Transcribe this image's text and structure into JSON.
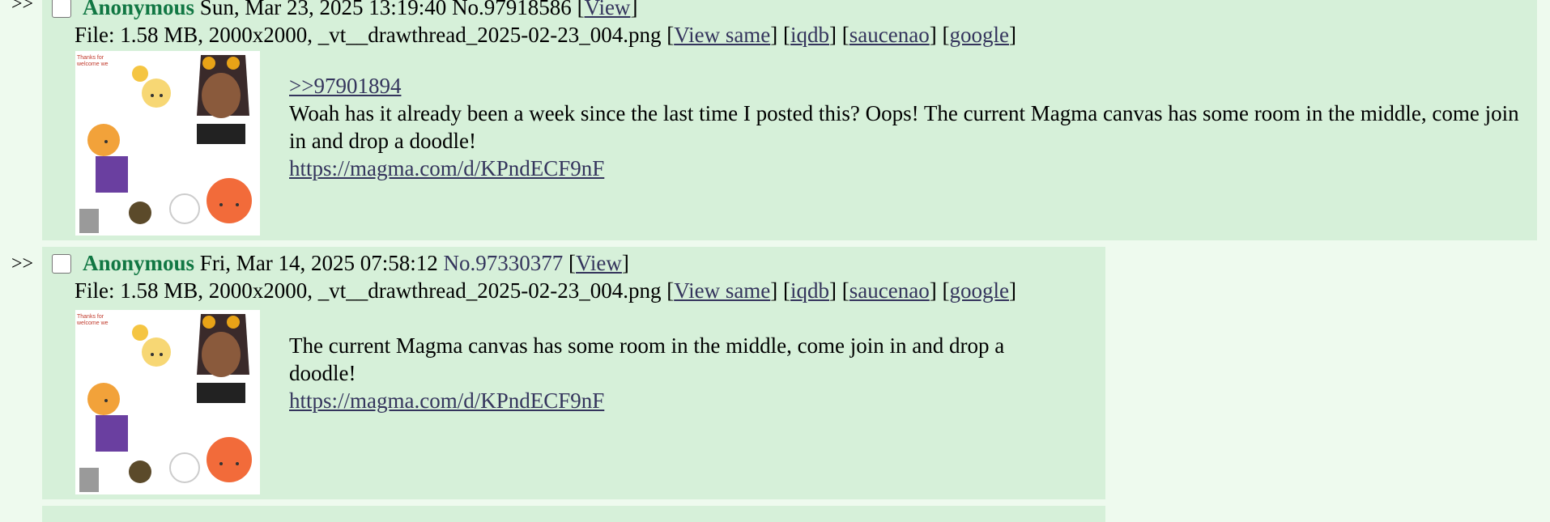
{
  "posts": [
    {
      "arrows": ">>",
      "name": "Anonymous",
      "date": "Sun, Mar 23, 2025 13:19:40",
      "number": "No.97918586",
      "view_label": "View",
      "file": {
        "prefix": "File: 1.58 MB, 2000x2000, _vt__drawthread_2025-02-23_004.png",
        "view_same": "View same",
        "iqdb": "iqdb",
        "saucenao": "saucenao",
        "google": "google"
      },
      "quote": ">>97901894",
      "text": "Woah has it already been a week since the last time I posted this? Oops! The current Magma canvas has some room in the middle, come join in and drop a doodle!",
      "link": "https://magma.com/d/KPndECF9nF"
    },
    {
      "arrows": ">>",
      "name": "Anonymous",
      "date": "Fri, Mar 14, 2025 07:58:12",
      "number": "No.97330377",
      "view_label": "View",
      "file": {
        "prefix": "File: 1.58 MB, 2000x2000, _vt__drawthread_2025-02-23_004.png",
        "view_same": "View same",
        "iqdb": "iqdb",
        "saucenao": "saucenao",
        "google": "google"
      },
      "text": "The current Magma canvas has some room in the middle, come join in and drop a doodle!",
      "link": "https://magma.com/d/KPndECF9nF"
    }
  ],
  "colors": {
    "page_bg": "#eefaee",
    "post_bg": "#d6f0d9",
    "name": "#117743",
    "link": "#34345c"
  }
}
